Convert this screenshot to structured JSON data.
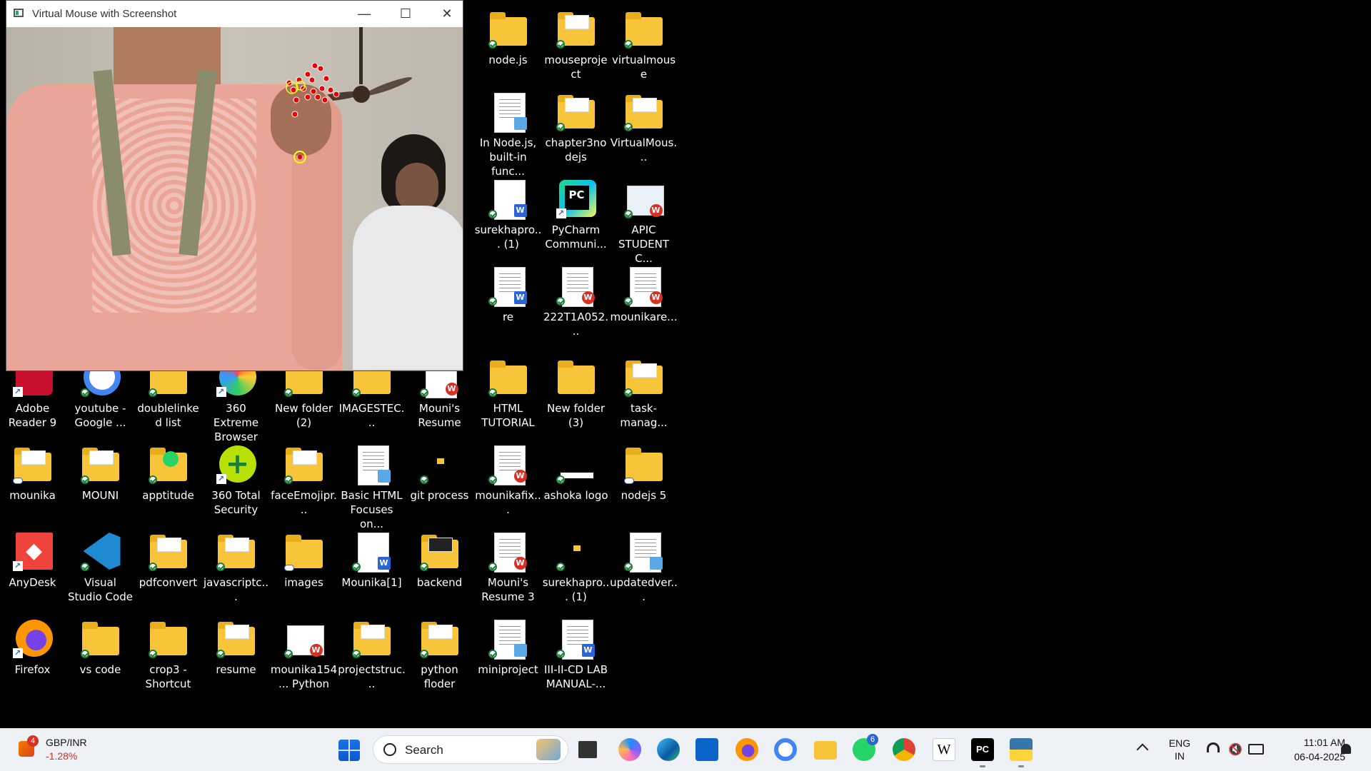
{
  "window": {
    "title": "Virtual Mouse with Screenshot",
    "minimize": "—",
    "maximize": "☐",
    "close": "✕"
  },
  "desktop": {
    "icons": [
      {
        "label": "node.js",
        "type": "folder"
      },
      {
        "label": "mouseproject",
        "type": "folder"
      },
      {
        "label": "virtualmouse",
        "type": "folder"
      },
      {
        "label": "In Node.js, built-in func...",
        "type": "notepad"
      },
      {
        "label": "chapter3nodejs",
        "type": "folder"
      },
      {
        "label": "VirtualMous...",
        "type": "folder"
      },
      {
        "label": "surekhapro... (1)",
        "type": "word"
      },
      {
        "label": "PyCharm Communi...",
        "type": "pycharm"
      },
      {
        "label": "APIC STUDENT C...",
        "type": "pdf"
      },
      {
        "label": "re",
        "type": "word"
      },
      {
        "label": "222T1A052...",
        "type": "pdf"
      },
      {
        "label": "mounikare...",
        "type": "pdf"
      },
      {
        "label": "Adobe Reader 9",
        "type": "adobe"
      },
      {
        "label": "youtube - Google ...",
        "type": "google"
      },
      {
        "label": "doublelinked list",
        "type": "folder"
      },
      {
        "label": "360 Extreme Browser",
        "type": "browser360"
      },
      {
        "label": "New folder (2)",
        "type": "folder"
      },
      {
        "label": "IMAGESTEC...",
        "type": "folder"
      },
      {
        "label": "Mouni's Resume",
        "type": "pdf"
      },
      {
        "label": "HTML TUTORIAL",
        "type": "folder"
      },
      {
        "label": "New folder (3)",
        "type": "folder"
      },
      {
        "label": "task-manag...",
        "type": "folder"
      },
      {
        "label": "mounika",
        "type": "folder"
      },
      {
        "label": "MOUNI",
        "type": "folder"
      },
      {
        "label": "apptitude",
        "type": "folder"
      },
      {
        "label": "360 Total Security",
        "type": "security360"
      },
      {
        "label": "faceEmojipr...",
        "type": "folder"
      },
      {
        "label": "Basic HTML Focuses on...",
        "type": "notepad"
      },
      {
        "label": "git process",
        "type": "small-folder"
      },
      {
        "label": "mounikafix...",
        "type": "pdf"
      },
      {
        "label": "ashoka logo",
        "type": "image"
      },
      {
        "label": "nodejs 5",
        "type": "folder"
      },
      {
        "label": "AnyDesk",
        "type": "anydesk"
      },
      {
        "label": "Visual Studio Code",
        "type": "vscode"
      },
      {
        "label": "pdfconvert",
        "type": "folder"
      },
      {
        "label": "javascriptc...",
        "type": "folder"
      },
      {
        "label": "images",
        "type": "folder"
      },
      {
        "label": "Mounika[1]",
        "type": "word"
      },
      {
        "label": "backend",
        "type": "folder"
      },
      {
        "label": "Mouni's Resume 3",
        "type": "pdf"
      },
      {
        "label": "surekhapro... (1)",
        "type": "small-folder"
      },
      {
        "label": "updatedver...",
        "type": "notepad"
      },
      {
        "label": "Firefox",
        "type": "firefox"
      },
      {
        "label": "vs code",
        "type": "folder"
      },
      {
        "label": "crop3 - Shortcut",
        "type": "folder"
      },
      {
        "label": "resume",
        "type": "folder"
      },
      {
        "label": "mounika154... Python",
        "type": "pdf"
      },
      {
        "label": "projectstruc...",
        "type": "folder"
      },
      {
        "label": "python floder",
        "type": "folder"
      },
      {
        "label": "miniproject",
        "type": "notepad"
      },
      {
        "label": "III-II-CD LAB MANUAL-...",
        "type": "word"
      }
    ]
  },
  "taskbar": {
    "weather": {
      "badge": "4",
      "title": "GBP/INR",
      "change": "-1.28%"
    },
    "search_placeholder": "Search",
    "whatsapp_badge": "6",
    "language": "ENG",
    "region": "IN",
    "time": "11:01 AM",
    "date": "06-04-2025"
  },
  "colors": {
    "folder": "#f8c53a",
    "taskbar_bg": "#eef1f6",
    "accent": "#2b63d9"
  }
}
